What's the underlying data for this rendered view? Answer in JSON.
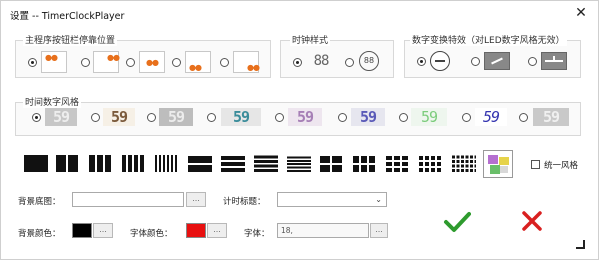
{
  "window": {
    "title": "设置 -- TimerClockPlayer",
    "close_glyph": "✕"
  },
  "groups": {
    "button_position": "主程序按钮栏停靠位置",
    "clock_style": "时钟样式",
    "digit_effect": "数字变换特效（对LED数字风格无效）",
    "digit_style": "时间数字风格"
  },
  "clock_style": {
    "digital": "88",
    "analog": "88"
  },
  "digit_styles": [
    "59",
    "59",
    "59",
    "59",
    "59",
    "59",
    "59",
    "59",
    "59"
  ],
  "colors": {
    "bg_swatch": "#000000",
    "font_swatch": "#e81010",
    "ok": "#2e9b2e",
    "cancel": "#d92020",
    "digit_orange": "#e8701c"
  },
  "unify": {
    "label": "统一风格",
    "checked": false
  },
  "form": {
    "bg_image_label": "背景底图：",
    "bg_image_value": "",
    "browse": "...",
    "timer_title_label": "计时标题：",
    "timer_title_value": "",
    "bg_color_label": "背景颜色：",
    "font_color_label": "字体颜色：",
    "font_label": "字体：",
    "font_value": "18,"
  },
  "icons": {
    "ok": "checkmark-icon",
    "cancel": "cross-icon",
    "resize": "resize-grip-icon"
  }
}
